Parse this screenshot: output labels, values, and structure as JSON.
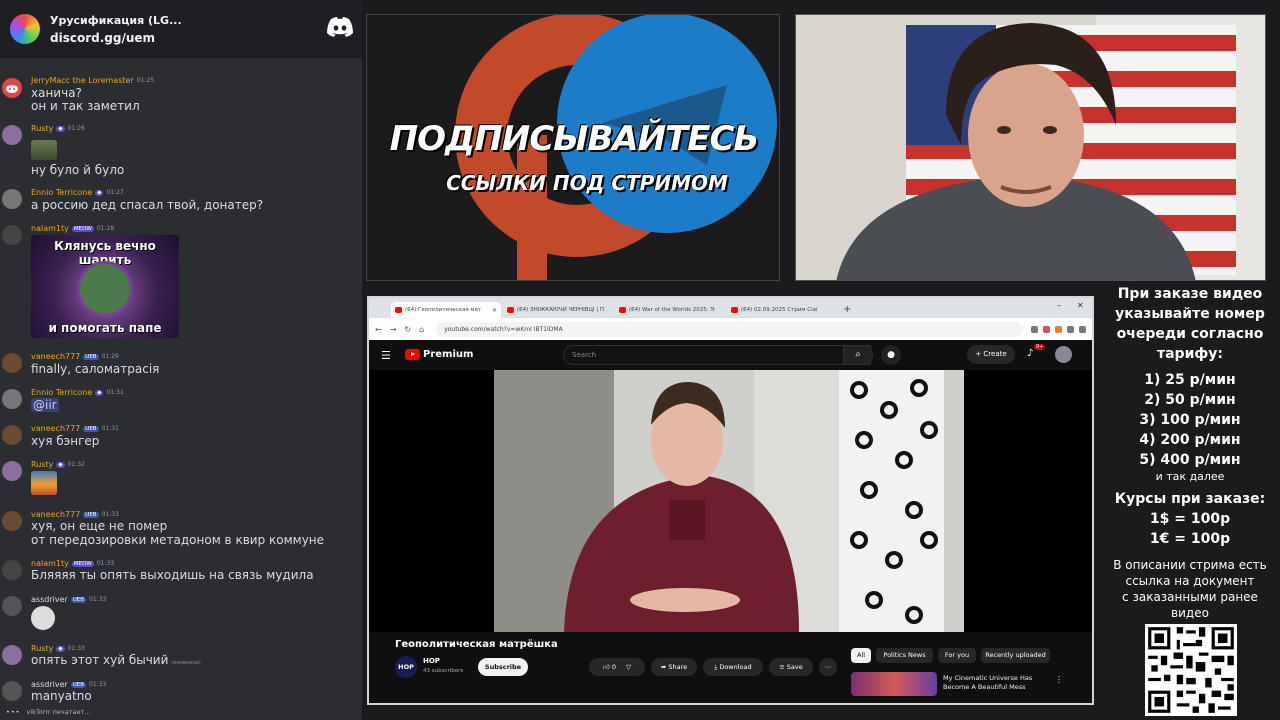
{
  "chat": {
    "header_title": "Урусификация (LG...",
    "header_link": "discord.gg/uem",
    "typing": "vikTorrr печатает..."
  },
  "messages": [
    {
      "user": "JerryMacc the Loremaster",
      "time": "01:25",
      "color": "#e8a820",
      "lines": [
        "ханича?",
        "он и так заметил"
      ]
    },
    {
      "user": "Rusty",
      "time": "01:26",
      "color": "#e8a820",
      "lines": [
        "ну було й було"
      ]
    },
    {
      "user": "Ennio Terricone",
      "time": "01:27",
      "color": "#e8a820",
      "lines": [
        "а россию дед спасал твой, донатер?"
      ]
    },
    {
      "user": "nalam1ty",
      "badge": "MEOW",
      "time": "01:28",
      "color": "#e8a820",
      "emote_top": "Клянусь вечно шарить",
      "emote_bottom": "и помогать папе",
      "lines": []
    },
    {
      "user": "vaneech777",
      "badge": "UEB",
      "time": "01:29",
      "color": "#e8a820",
      "lines": [
        "finally, саломатрасія"
      ]
    },
    {
      "user": "Ennio Terricone",
      "time": "01:31",
      "color": "#e8a820",
      "lines": [
        "@iir"
      ]
    },
    {
      "user": "vaneech777",
      "badge": "UEB",
      "time": "01:31",
      "color": "#e8a820",
      "lines": [
        "хуя бэнгер"
      ]
    },
    {
      "user": "Rusty",
      "time": "01:32",
      "color": "#e8a820",
      "lines": []
    },
    {
      "user": "vaneech777",
      "badge": "UEB",
      "time": "01:33",
      "color": "#e8a820",
      "lines": [
        "хуя, он еще не помер",
        "от передозировки метадоном в квир коммуне"
      ]
    },
    {
      "user": "nalam1ty",
      "badge": "MEOW",
      "time": "01:33",
      "color": "#e8a820",
      "lines": [
        "Бляяяя ты опять выходишь на связь мудила"
      ]
    },
    {
      "user": "assdriver",
      "badge": "UEB",
      "time": "01:33",
      "color": "#dbdee1",
      "lines": []
    },
    {
      "user": "Rusty",
      "time": "01:33",
      "color": "#e8a820",
      "lines": [
        "опять этот хуй бычий"
      ],
      "note": "(изменено)"
    },
    {
      "user": "assdriver",
      "badge": "UEB",
      "time": "01:33",
      "color": "#dbdee1",
      "lines": [
        "manyatno"
      ]
    }
  ],
  "banner": {
    "title": "ПОДПИСЫВАЙТЕСЬ",
    "subtitle": "ССЫЛКИ ПОД СТРИМОМ"
  },
  "browser": {
    "tabs": [
      {
        "label": "(64) Геополитическая мат"
      },
      {
        "label": "(64) ЗНІЖКАЮЧИ ЧЕРНІВЦІ | П"
      },
      {
        "label": "(64) War of the Worlds 2025: Tr"
      },
      {
        "label": "(64) 02.09.2025 Стрим Clai"
      }
    ],
    "url": "youtube.com/watch?v=wKml IBT1IDMA"
  },
  "youtube": {
    "logo_text": "Premium",
    "search_placeholder": "Search",
    "create_label": "+ Create",
    "notifications": "9+",
    "video_title": "Геополитическая матрёшка",
    "channel_avatar_text": "HOP",
    "channel_name": "HOP",
    "subscribers": "43 subscribers",
    "subscribe_label": "Subscribe",
    "likes": "0",
    "share_label": "Share",
    "download_label": "Download",
    "save_label": "Save",
    "chips": [
      "All",
      "Politics News",
      "For you",
      "Recently uploaded"
    ],
    "rec_title": "My Cinematic Universe Has Become A Beautiful Mess"
  },
  "info": {
    "order_lines": [
      "При заказе видео",
      "указывайте номер",
      "очереди согласно",
      "тарифу:"
    ],
    "tariffs": [
      "1) 25 р/мин",
      "2) 50 р/мин",
      "3) 100 р/мин",
      "4) 200 р/мин",
      "5) 400 р/мин"
    ],
    "etc": "и так далее",
    "rates_title": "Курсы при заказе:",
    "rates": [
      "1$ = 100р",
      "1€ = 100р"
    ],
    "desc_lines": [
      "В описании стрима есть",
      "ссылка на документ",
      "с заказанными ранее",
      "видео"
    ]
  }
}
